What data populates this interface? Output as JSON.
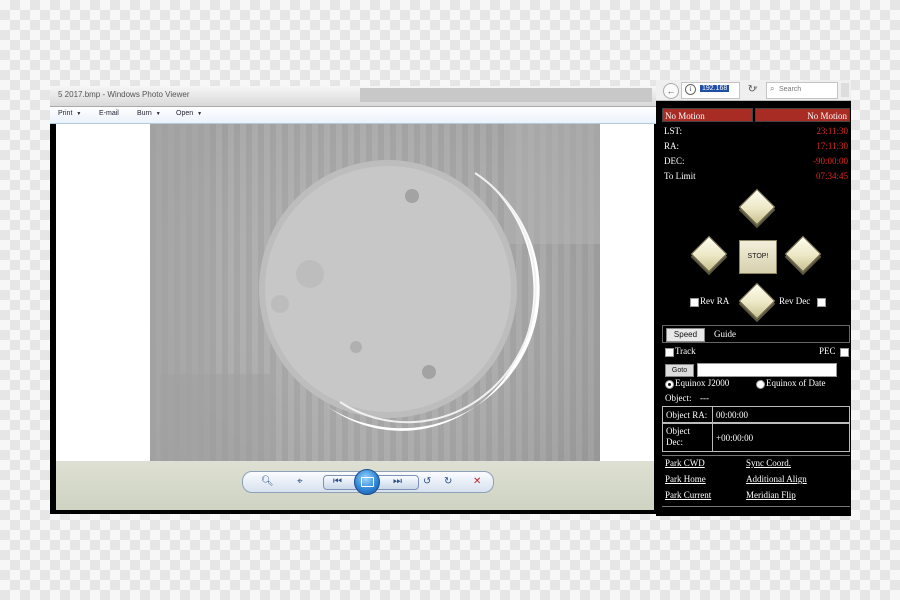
{
  "viewer": {
    "title": "5 2017.bmp - Windows Photo Viewer",
    "menu": [
      "Print",
      "E-mail",
      "Burn",
      "Open"
    ],
    "controls": {
      "zoom_icon": "magnifier-icon",
      "fit_icon": "actual-size-icon",
      "prev_icon": "previous-icon",
      "slideshow_icon": "slideshow-icon",
      "next_icon": "next-icon",
      "rotate_ccw_icon": "rotate-counterclockwise-icon",
      "rotate_cw_icon": "rotate-clockwise-icon",
      "delete_icon": "delete-icon"
    },
    "image_subject": "crescent moon"
  },
  "browser": {
    "url": "192.168",
    "search_placeholder": "Search"
  },
  "telescope": {
    "status_left": "No Motion",
    "status_right": "No Motion",
    "info": [
      {
        "label": "LST:",
        "value": "23:11:30"
      },
      {
        "label": "RA:",
        "value": "17:11:30"
      },
      {
        "label": "DEC:",
        "value": "-90:00:00"
      },
      {
        "label": "To Limit",
        "value": "07:34:45"
      }
    ],
    "stop_label": "STOP!",
    "rev_ra": "Rev RA",
    "rev_dec": "Rev Dec",
    "speed_label": "Speed",
    "guide_label": "Guide",
    "track_label": "Track",
    "pec_label": "PEC",
    "goto_label": "Goto",
    "equinox_j2000": "Equinox J2000",
    "equinox_date": "Equinox of Date",
    "object_label": "Object:",
    "object_value": "---",
    "object_ra_label": "Object RA:",
    "object_ra_value": "00:00:00",
    "object_dec_label_1": "Object",
    "object_dec_label_2": "Dec:",
    "object_dec_value": "+00:00:00",
    "links": {
      "park_cwd": "Park CWD",
      "sync_coord": "Sync Coord.",
      "park_home": "Park Home",
      "additional_align": "Additional Align",
      "park_current": "Park Current",
      "meridian_flip": "Meridian Flip"
    }
  },
  "colors": {
    "status_bg": "#a82c24",
    "value_red": "#e0291f",
    "panel_bg": "#000000"
  }
}
